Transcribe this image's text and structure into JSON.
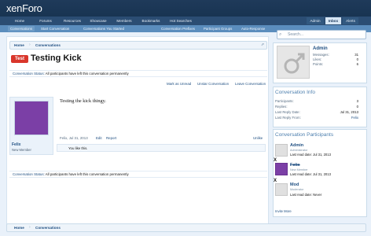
{
  "header": {
    "logo_main": "xen",
    "logo_accent": "Foro"
  },
  "nav": {
    "tabs": [
      {
        "label": "Home"
      },
      {
        "label": "Forums"
      },
      {
        "label": "Resources"
      },
      {
        "label": "Showcase"
      },
      {
        "label": "Members"
      },
      {
        "label": "Bookmarks"
      },
      {
        "label": "Hot Searches"
      }
    ],
    "right_tabs": [
      {
        "label": "Admin"
      },
      {
        "label": "Inbox"
      },
      {
        "label": "Alerts"
      }
    ]
  },
  "subnav": {
    "left": [
      "Conversations",
      "Start Conversation",
      "Conversations You Started"
    ],
    "right": [
      "Conversation Prefixes",
      "Participant Groups",
      "Auto-Response"
    ]
  },
  "breadcrumb": {
    "items": [
      "Home",
      "Conversations"
    ],
    "jump_glyph": "⇗"
  },
  "thread": {
    "prefix": "Test",
    "title": "Testing Kick"
  },
  "status": {
    "label": "Conversation Status:",
    "message": "All participants have left this conversation permanently"
  },
  "actions": [
    "Mark as Unread",
    "Unstar Conversation",
    "Leave Conversation"
  ],
  "message": {
    "username": "Felix",
    "user_title": "New Member",
    "body": "Testing the kick thingy.",
    "date": "Felix, Jul 31, 2013",
    "edit": "Edit",
    "report": "Report",
    "like": "Unlike",
    "likes_text": "You like this.",
    "avatar_color": "#7b3fa6"
  },
  "sidebar": {
    "search_placeholder": "Search...",
    "visitor": {
      "name": "Admin",
      "stats": [
        {
          "label": "Messages:",
          "value": "31"
        },
        {
          "label": "Likes:",
          "value": "0"
        },
        {
          "label": "Points:",
          "value": "6"
        }
      ]
    },
    "conversation_info": {
      "heading": "Conversation Info",
      "rows": [
        {
          "label": "Participants:",
          "value": "3"
        },
        {
          "label": "Replies:",
          "value": "0"
        },
        {
          "label": "Last Reply Date:",
          "value": "Jul 31, 2013"
        },
        {
          "label": "Last Reply From:",
          "value": "Felix"
        }
      ]
    },
    "participants": {
      "heading": "Conversation Participants",
      "list": [
        {
          "name": "Admin",
          "role": "Administrator",
          "last_read": "Last read date: Jul 31, 2013",
          "kicked": ""
        },
        {
          "name": "Felix",
          "role": "New Member",
          "last_read": "Last read date: Jul 31, 2013",
          "kicked": "X"
        },
        {
          "name": "Mod",
          "role": "Moderator",
          "last_read": "Last read date: Never",
          "kicked": "X"
        }
      ],
      "invite_more": "Invite More"
    }
  },
  "bottom_breadcrumb": {
    "items": [
      "Home",
      "Conversations"
    ]
  }
}
